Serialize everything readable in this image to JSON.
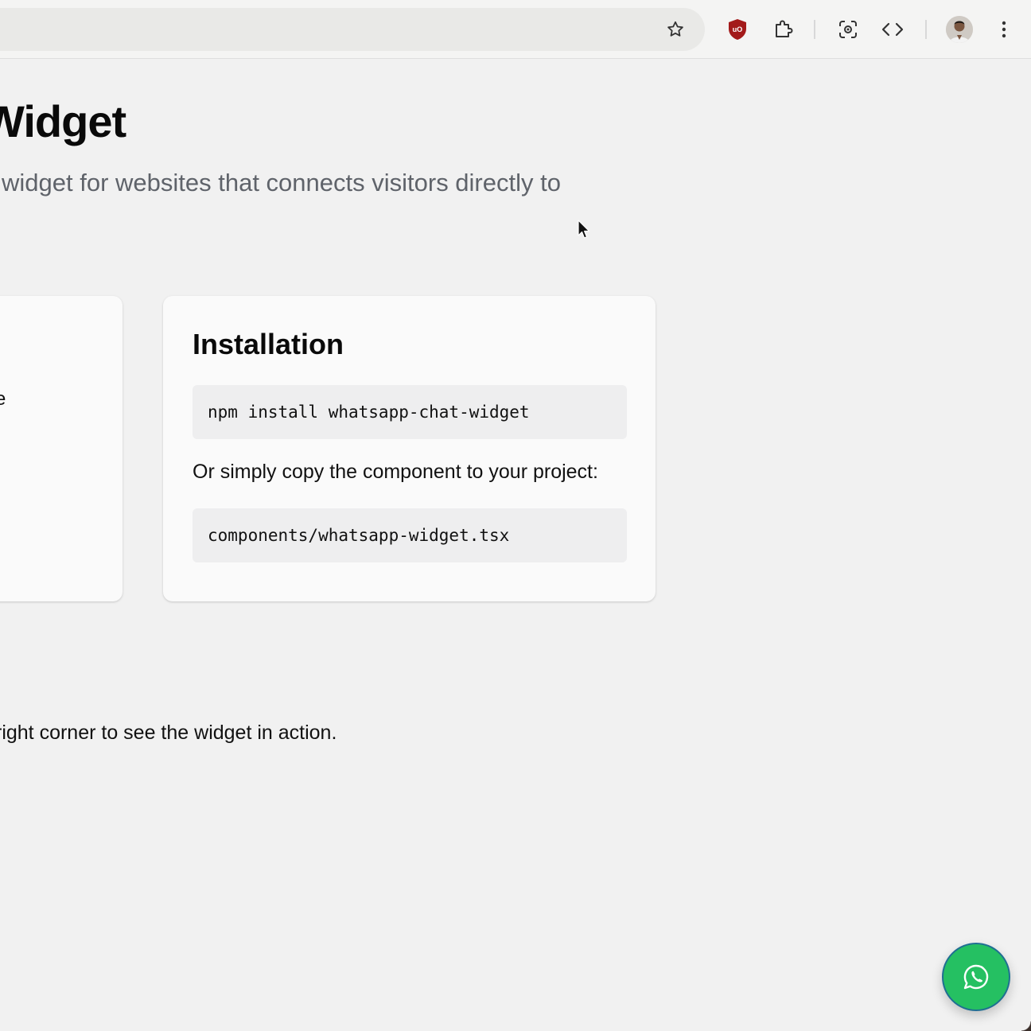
{
  "browser": {
    "toolbar_icons": [
      "star-icon",
      "ublock-origin-icon",
      "extensions-icon",
      "google-lens-icon",
      "devtools-code-icon",
      "profile-avatar",
      "more-menu-icon"
    ]
  },
  "hero": {
    "title": "Widget",
    "subtitle": "widget for websites that connects visitors directly to"
  },
  "left_card": {
    "fragment": "e"
  },
  "installation": {
    "title": "Installation",
    "npm_command": "npm install whatsapp-chat-widget",
    "copy_text": "Or simply copy the component to your project:",
    "component_path": "components/whatsapp-widget.tsx"
  },
  "demo": {
    "text": "right corner to see the widget in action."
  },
  "fab": {
    "icon": "whatsapp-icon",
    "color": "#25c062"
  },
  "colors": {
    "background": "#f1f1f1",
    "ublock_red": "#a31a1a",
    "whatsapp_green": "#25c062"
  }
}
